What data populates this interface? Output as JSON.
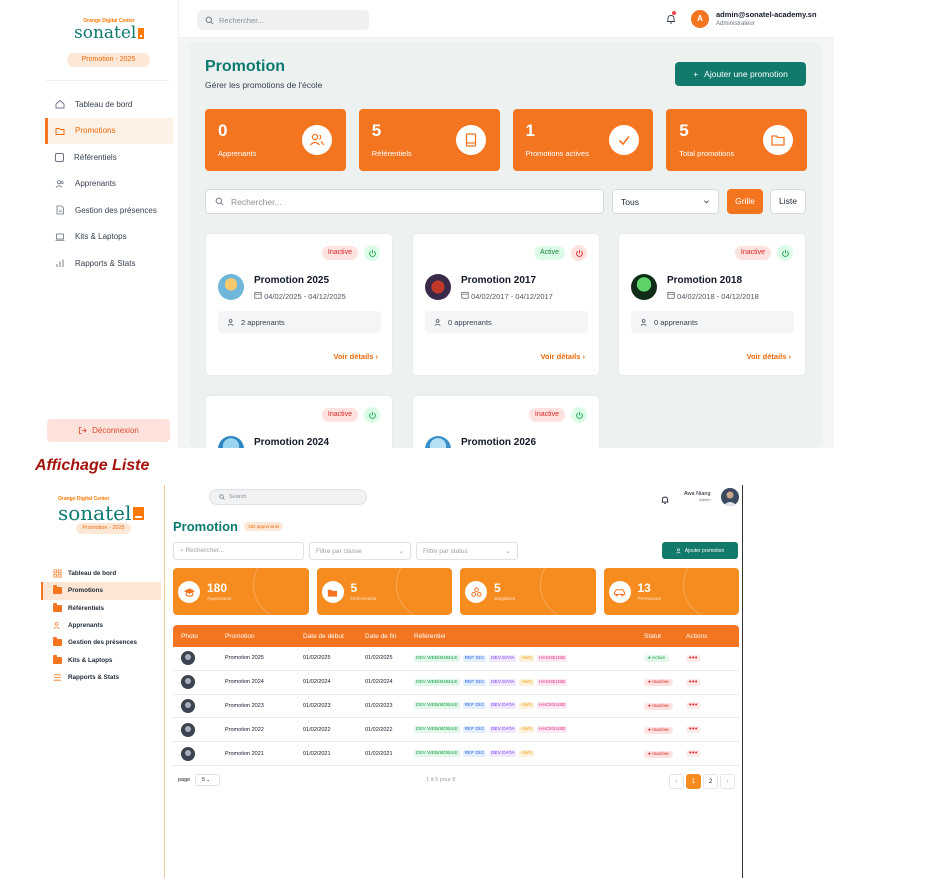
{
  "grid_view": {
    "sidebar": {
      "logo_small": "Orange Digital Center",
      "logo_word": "sonatel",
      "promotion_pill": "Promotion - 2025",
      "nav": [
        {
          "label": "Tableau de bord",
          "icon": "home-icon"
        },
        {
          "label": "Promotions",
          "icon": "folder-icon",
          "active": true
        },
        {
          "label": "Référentiels",
          "icon": "book-icon"
        },
        {
          "label": "Apprenants",
          "icon": "users-icon"
        },
        {
          "label": "Gestion des présences",
          "icon": "document-icon"
        },
        {
          "label": "Kits & Laptops",
          "icon": "laptop-icon"
        },
        {
          "label": "Rapports & Stats",
          "icon": "bar-chart-icon"
        }
      ],
      "logout": "Déconnexion"
    },
    "header": {
      "search_placeholder": "Rechercher...",
      "avatar_initial": "A",
      "email": "admin@sonatel-academy.sn",
      "role": "Administrateur"
    },
    "title": "Promotion",
    "subtitle": "Gérer les promotions de l'école",
    "add_button": "Ajouter une promotion",
    "stats": [
      {
        "value": "0",
        "label": "Apprenants",
        "icon": "users-icon"
      },
      {
        "value": "5",
        "label": "Référentiels",
        "icon": "book-icon"
      },
      {
        "value": "1",
        "label": "Promotions actives",
        "icon": "check-icon"
      },
      {
        "value": "5",
        "label": "Total promotions",
        "icon": "folder-icon"
      }
    ],
    "filter_placeholder": "Rechercher...",
    "status_select": "Tous",
    "view_grid": "Grille",
    "view_list": "Liste",
    "cards": [
      {
        "status": "Inactive",
        "name": "Promotion 2025",
        "dates": "04/02/2025 - 04/12/2025",
        "learners": "2 apprenants",
        "link": "Voir détails"
      },
      {
        "status": "Active",
        "name": "Promotion 2017",
        "dates": "04/02/2017 - 04/12/2017",
        "learners": "0 apprenants",
        "link": "Voir détails"
      },
      {
        "status": "Inactive",
        "name": "Promotion 2018",
        "dates": "04/02/2018 - 04/12/2018",
        "learners": "0 apprenants",
        "link": "Voir détails"
      },
      {
        "status": "Inactive",
        "name": "Promotion 2024"
      },
      {
        "status": "Inactive",
        "name": "Promotion 2026"
      }
    ]
  },
  "section_title": "Affichage Liste",
  "list_view": {
    "sidebar": {
      "logo_small": "Orange Digital Center",
      "logo_word": "sonatel",
      "promotion_pill": "Promotion - 2025",
      "nav": [
        {
          "label": "Tableau de bord"
        },
        {
          "label": "Promotions",
          "active": true
        },
        {
          "label": "Référentiels"
        },
        {
          "label": "Apprenants"
        },
        {
          "label": "Gestion des présences"
        },
        {
          "label": "Kits & Laptops"
        },
        {
          "label": "Rapports & Stats"
        }
      ]
    },
    "header": {
      "search_placeholder": "Search",
      "user_name": "Awa Niang",
      "user_role": "Admin"
    },
    "title": "Promotion",
    "title_pill": "180 apprenants",
    "search_placeholder": "Rechercher...",
    "filter_class": "Filtre par classe",
    "filter_status": "Filtre par status",
    "add_button": "Ajouter promotion",
    "stats": [
      {
        "value": "180",
        "label": "Apprenants"
      },
      {
        "value": "5",
        "label": "Referentiels"
      },
      {
        "value": "5",
        "label": "Stagiaires"
      },
      {
        "value": "13",
        "label": "Permanant"
      }
    ],
    "table": {
      "headers": [
        "Photo",
        "Promotion",
        "Date de début",
        "Date de fin",
        "Référentiel",
        "Statut",
        "Actions"
      ],
      "rows": [
        {
          "name": "Promotion 2025",
          "start": "01/02/2025",
          "end": "01/02/2025",
          "refs": [
            "DEV WEB/MOBILE",
            "REF DIG",
            "DEV DATA",
            "AWS",
            "HACKEUSE"
          ],
          "status": "Active"
        },
        {
          "name": "Promotion 2024",
          "start": "01/02/2024",
          "end": "01/02/2024",
          "refs": [
            "DEV WEB/MOBILE",
            "REF DIG",
            "DEV DATA",
            "AWS",
            "HACKEUSE"
          ],
          "status": "Inactive"
        },
        {
          "name": "Promotion 2023",
          "start": "01/02/2023",
          "end": "01/02/2023",
          "refs": [
            "DEV WEB/MOBILE",
            "REF DIG",
            "DEV DATA",
            "AWS",
            "HACKEUSE"
          ],
          "status": "Inactive"
        },
        {
          "name": "Promotion 2022",
          "start": "01/02/2022",
          "end": "01/02/2022",
          "refs": [
            "DEV WEB/MOBILE",
            "REF DIG",
            "DEV DATA",
            "AWS",
            "HACKEUSE"
          ],
          "status": "Inactive"
        },
        {
          "name": "Promotion 2021",
          "start": "01/02/2021",
          "end": "01/02/2021",
          "refs": [
            "DEV WEB/MOBILE",
            "REF DIG",
            "DEV DATA",
            "AWS"
          ],
          "status": "Inactive"
        }
      ],
      "actions_label": "•••"
    },
    "footer": {
      "page_label": "page",
      "page_size": "5",
      "count_text": "1 à 5  pour 8",
      "prev": "‹",
      "pages": [
        "1",
        "2"
      ],
      "next": "›"
    }
  },
  "colors": {
    "brand_orange": "#f37520",
    "brand_teal": "#0d7a70",
    "active_green": "#16a34a",
    "inactive_red": "#dc2626"
  }
}
